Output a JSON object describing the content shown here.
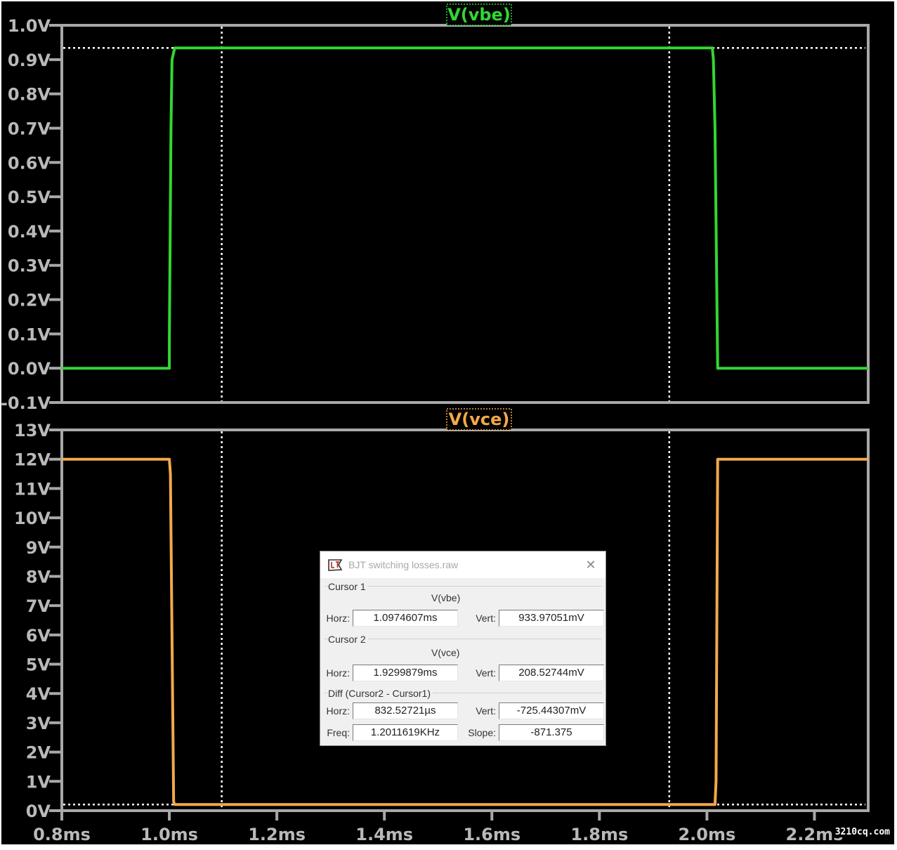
{
  "watermark": "3210cq.com",
  "colors": {
    "background": "#000000",
    "frame": "#a8a8a8",
    "axis_text": "#b9b9b9",
    "vbe_trace": "#33d633",
    "vce_trace": "#f2a94a",
    "cursor_line": "#ffffff"
  },
  "chart_data": [
    {
      "type": "line",
      "title": "V(vbe)",
      "x_ticks": [
        "0.8ms",
        "1.0ms",
        "1.2ms",
        "1.4ms",
        "1.6ms",
        "1.8ms",
        "2.0ms",
        "2.2ms"
      ],
      "y_ticks": [
        "1.0V",
        "0.9V",
        "0.8V",
        "0.7V",
        "0.6V",
        "0.5V",
        "0.4V",
        "0.3V",
        "0.2V",
        "0.1V",
        "0.0V",
        "-0.1V"
      ],
      "xlim": [
        0.8,
        2.3
      ],
      "ylim": [
        -0.1,
        1.0
      ],
      "x_unit": "ms",
      "y_unit": "V",
      "series": [
        {
          "name": "V(vbe)",
          "x": [
            0.8,
            1.0,
            1.0,
            1.003,
            1.005,
            1.01,
            2.01,
            2.012,
            2.015,
            2.02,
            2.3
          ],
          "y": [
            0.0,
            0.0,
            0.08,
            0.7,
            0.9,
            0.934,
            0.934,
            0.9,
            0.7,
            0.0,
            0.0
          ]
        }
      ],
      "cursor_lines_x": [
        1.0974607,
        1.9299879
      ],
      "cursor_line_y": 0.93397051
    },
    {
      "type": "line",
      "title": "V(vce)",
      "x_ticks": [
        "0.8ms",
        "1.0ms",
        "1.2ms",
        "1.4ms",
        "1.6ms",
        "1.8ms",
        "2.0ms",
        "2.2ms"
      ],
      "y_ticks": [
        "13V",
        "12V",
        "11V",
        "10V",
        "9V",
        "8V",
        "7V",
        "6V",
        "5V",
        "4V",
        "3V",
        "2V",
        "1V",
        "0V"
      ],
      "xlim": [
        0.8,
        2.3
      ],
      "ylim": [
        0,
        13
      ],
      "x_unit": "ms",
      "y_unit": "V",
      "series": [
        {
          "name": "V(vce)",
          "x": [
            0.8,
            1.0,
            1.002,
            1.008,
            1.01,
            2.015,
            2.017,
            2.02,
            2.3
          ],
          "y": [
            12.0,
            12.0,
            11.5,
            0.3,
            0.21,
            0.21,
            1.0,
            12.0,
            12.0
          ]
        }
      ],
      "cursor_lines_x": [
        1.0974607,
        1.9299879
      ],
      "cursor_line_y": 0.20852744
    }
  ],
  "dialog": {
    "title": "BJT switching losses.raw",
    "close_icon": "close-icon",
    "cursor1": {
      "label": "Cursor 1",
      "trace": "V(vbe)",
      "horz_label": "Horz:",
      "horz": "1.0974607ms",
      "vert_label": "Vert:",
      "vert": "933.97051mV"
    },
    "cursor2": {
      "label": "Cursor 2",
      "trace": "V(vce)",
      "horz_label": "Horz:",
      "horz": "1.9299879ms",
      "vert_label": "Vert:",
      "vert": "208.52744mV"
    },
    "diff": {
      "label": "Diff (Cursor2 - Cursor1)",
      "horz_label": "Horz:",
      "horz": "832.52721µs",
      "vert_label": "Vert:",
      "vert": "-725.44307mV",
      "freq_label": "Freq:",
      "freq": "1.2011619KHz",
      "slope_label": "Slope:",
      "slope": "-871.375"
    }
  }
}
